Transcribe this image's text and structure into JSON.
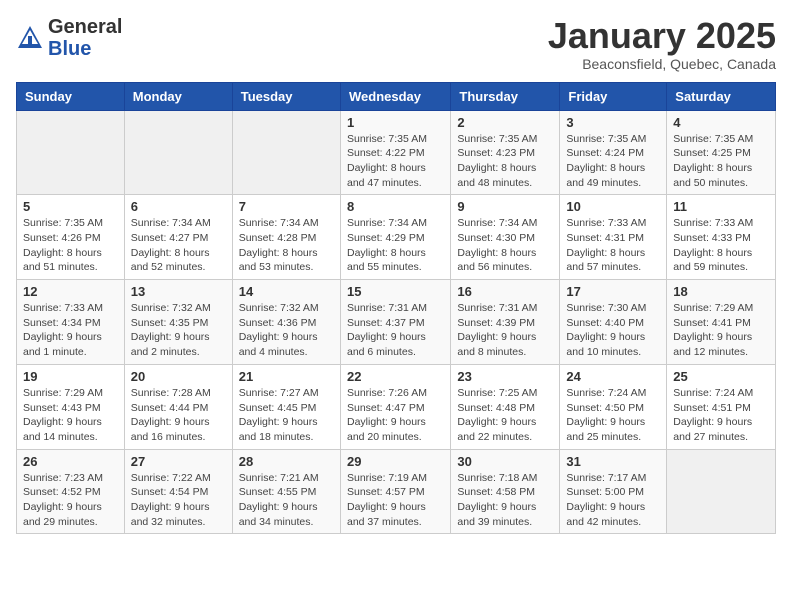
{
  "header": {
    "logo_general": "General",
    "logo_blue": "Blue",
    "month_title": "January 2025",
    "location": "Beaconsfield, Quebec, Canada"
  },
  "days_of_week": [
    "Sunday",
    "Monday",
    "Tuesday",
    "Wednesday",
    "Thursday",
    "Friday",
    "Saturday"
  ],
  "weeks": [
    [
      {
        "day": "",
        "info": ""
      },
      {
        "day": "",
        "info": ""
      },
      {
        "day": "",
        "info": ""
      },
      {
        "day": "1",
        "info": "Sunrise: 7:35 AM\nSunset: 4:22 PM\nDaylight: 8 hours and 47 minutes."
      },
      {
        "day": "2",
        "info": "Sunrise: 7:35 AM\nSunset: 4:23 PM\nDaylight: 8 hours and 48 minutes."
      },
      {
        "day": "3",
        "info": "Sunrise: 7:35 AM\nSunset: 4:24 PM\nDaylight: 8 hours and 49 minutes."
      },
      {
        "day": "4",
        "info": "Sunrise: 7:35 AM\nSunset: 4:25 PM\nDaylight: 8 hours and 50 minutes."
      }
    ],
    [
      {
        "day": "5",
        "info": "Sunrise: 7:35 AM\nSunset: 4:26 PM\nDaylight: 8 hours and 51 minutes."
      },
      {
        "day": "6",
        "info": "Sunrise: 7:34 AM\nSunset: 4:27 PM\nDaylight: 8 hours and 52 minutes."
      },
      {
        "day": "7",
        "info": "Sunrise: 7:34 AM\nSunset: 4:28 PM\nDaylight: 8 hours and 53 minutes."
      },
      {
        "day": "8",
        "info": "Sunrise: 7:34 AM\nSunset: 4:29 PM\nDaylight: 8 hours and 55 minutes."
      },
      {
        "day": "9",
        "info": "Sunrise: 7:34 AM\nSunset: 4:30 PM\nDaylight: 8 hours and 56 minutes."
      },
      {
        "day": "10",
        "info": "Sunrise: 7:33 AM\nSunset: 4:31 PM\nDaylight: 8 hours and 57 minutes."
      },
      {
        "day": "11",
        "info": "Sunrise: 7:33 AM\nSunset: 4:33 PM\nDaylight: 8 hours and 59 minutes."
      }
    ],
    [
      {
        "day": "12",
        "info": "Sunrise: 7:33 AM\nSunset: 4:34 PM\nDaylight: 9 hours and 1 minute."
      },
      {
        "day": "13",
        "info": "Sunrise: 7:32 AM\nSunset: 4:35 PM\nDaylight: 9 hours and 2 minutes."
      },
      {
        "day": "14",
        "info": "Sunrise: 7:32 AM\nSunset: 4:36 PM\nDaylight: 9 hours and 4 minutes."
      },
      {
        "day": "15",
        "info": "Sunrise: 7:31 AM\nSunset: 4:37 PM\nDaylight: 9 hours and 6 minutes."
      },
      {
        "day": "16",
        "info": "Sunrise: 7:31 AM\nSunset: 4:39 PM\nDaylight: 9 hours and 8 minutes."
      },
      {
        "day": "17",
        "info": "Sunrise: 7:30 AM\nSunset: 4:40 PM\nDaylight: 9 hours and 10 minutes."
      },
      {
        "day": "18",
        "info": "Sunrise: 7:29 AM\nSunset: 4:41 PM\nDaylight: 9 hours and 12 minutes."
      }
    ],
    [
      {
        "day": "19",
        "info": "Sunrise: 7:29 AM\nSunset: 4:43 PM\nDaylight: 9 hours and 14 minutes."
      },
      {
        "day": "20",
        "info": "Sunrise: 7:28 AM\nSunset: 4:44 PM\nDaylight: 9 hours and 16 minutes."
      },
      {
        "day": "21",
        "info": "Sunrise: 7:27 AM\nSunset: 4:45 PM\nDaylight: 9 hours and 18 minutes."
      },
      {
        "day": "22",
        "info": "Sunrise: 7:26 AM\nSunset: 4:47 PM\nDaylight: 9 hours and 20 minutes."
      },
      {
        "day": "23",
        "info": "Sunrise: 7:25 AM\nSunset: 4:48 PM\nDaylight: 9 hours and 22 minutes."
      },
      {
        "day": "24",
        "info": "Sunrise: 7:24 AM\nSunset: 4:50 PM\nDaylight: 9 hours and 25 minutes."
      },
      {
        "day": "25",
        "info": "Sunrise: 7:24 AM\nSunset: 4:51 PM\nDaylight: 9 hours and 27 minutes."
      }
    ],
    [
      {
        "day": "26",
        "info": "Sunrise: 7:23 AM\nSunset: 4:52 PM\nDaylight: 9 hours and 29 minutes."
      },
      {
        "day": "27",
        "info": "Sunrise: 7:22 AM\nSunset: 4:54 PM\nDaylight: 9 hours and 32 minutes."
      },
      {
        "day": "28",
        "info": "Sunrise: 7:21 AM\nSunset: 4:55 PM\nDaylight: 9 hours and 34 minutes."
      },
      {
        "day": "29",
        "info": "Sunrise: 7:19 AM\nSunset: 4:57 PM\nDaylight: 9 hours and 37 minutes."
      },
      {
        "day": "30",
        "info": "Sunrise: 7:18 AM\nSunset: 4:58 PM\nDaylight: 9 hours and 39 minutes."
      },
      {
        "day": "31",
        "info": "Sunrise: 7:17 AM\nSunset: 5:00 PM\nDaylight: 9 hours and 42 minutes."
      },
      {
        "day": "",
        "info": ""
      }
    ]
  ]
}
